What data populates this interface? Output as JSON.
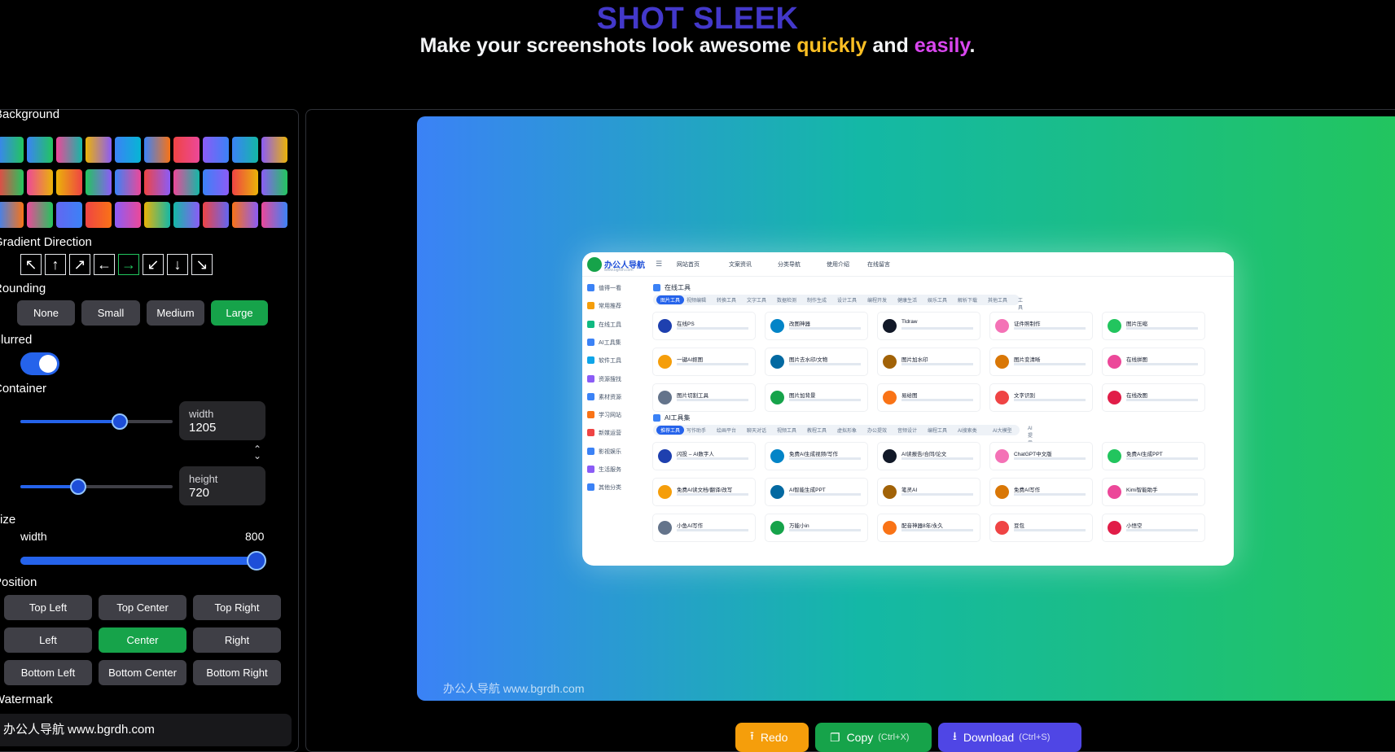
{
  "header": {
    "title": "SHOT SLEEK",
    "title_color": "#4338ca",
    "tagline_pre": "Make your screenshots look awesome ",
    "tagline_quick": "quickly",
    "tagline_and": " and ",
    "tagline_easy": "easily",
    "tagline_end": ".",
    "quick_color": "#fbbf24",
    "easy_color": "#d946ef"
  },
  "sidebar": {
    "background_label": "Background",
    "gradient_direction_label": "Gradient Direction",
    "directions": [
      "↖",
      "↑",
      "↗",
      "←",
      "→",
      "↙",
      "↓",
      "↘"
    ],
    "active_direction": "→",
    "rounding_label": "Rounding",
    "rounding_options": [
      "None",
      "Small",
      "Medium",
      "Large"
    ],
    "active_rounding": "Large",
    "blurred_label": "Blurred",
    "blurred": true,
    "container_label": "Container",
    "width_label": "width",
    "width_value": "1205",
    "width_slider": 0.65,
    "height_label": "height",
    "height_value": "720",
    "height_slider": 0.38,
    "size_label": "Size",
    "size_width_label": "width",
    "size_width_value": "800",
    "size_slider": 1.0,
    "position_label": "Position",
    "positions": [
      "Top Left",
      "Top Center",
      "Top Right",
      "Left",
      "Center",
      "Right",
      "Bottom Left",
      "Bottom Center",
      "Bottom Right"
    ],
    "active_position": "Center",
    "watermark_label": "Watermark",
    "watermark_value": "办公人导航 www.bgrdh.com"
  },
  "preview": {
    "watermark_text": "办公人导航 www.bgrdh.com",
    "site": {
      "brand": "办公人导航",
      "url": "www.bgrdh.com",
      "nav": [
        "网站首页",
        "文案资讯",
        "分类导航",
        "使用介绍",
        "在线留言"
      ],
      "side_items": [
        "值得一看",
        "常用推荐",
        "在线工具",
        "AI工具集",
        "软件工具",
        "资源搜找",
        "素材资源",
        "学习网站",
        "新媒运营",
        "影视娱乐",
        "生活服务",
        "其他分类"
      ],
      "section1": "在线工具",
      "tabs1": [
        "图片工具",
        "视频编辑",
        "转换工具",
        "文字工具",
        "数据检测",
        "制作生成",
        "设计工具",
        "编程开发",
        "健康生活",
        "娱乐工具",
        "解析下载",
        "其他工具",
        "工具合集"
      ],
      "cards1": [
        "在线PS",
        "改图神器",
        "Tldraw",
        "证件照制作",
        "图片压缩",
        "一键AI抠图",
        "图片去水印/文物",
        "图片加水印",
        "图片变清晰",
        "在线拼图",
        "图片切割工具",
        "图片加背景",
        "易给图",
        "文字识别",
        "在线改图"
      ],
      "section2": "AI工具集",
      "tabs2": [
        "推荐工具",
        "写作助手",
        "绘画平台",
        "聊天对话",
        "视频工具",
        "教程工具",
        "虚拟形象",
        "办公提效",
        "音频设计",
        "编程工具",
        "AI搜索类",
        "AI大模型",
        "AI提示词"
      ],
      "cards2": [
        "闪投 – AI数字人",
        "免费AI生成视频/写作",
        "AI读报告/合同/论文",
        "ChatGPT中文版",
        "免费AI生成PPT",
        "免费AI读文档/翻译/改写",
        "AI智能生成PPT",
        "笔灵AI",
        "免费AI写作",
        "Kimi智能助手",
        "小鱼AI写作",
        "万能小in",
        "配音神器8年/永久",
        "豆包",
        "小悟空"
      ]
    }
  },
  "actions": {
    "redo_label": "Redo",
    "copy_label": "Copy",
    "copy_hint": "(Ctrl+X)",
    "download_label": "Download",
    "download_hint": "(Ctrl+S)",
    "redo_color": "#f59e0b",
    "copy_color": "#16a34a",
    "download_color": "#4f46e5"
  }
}
